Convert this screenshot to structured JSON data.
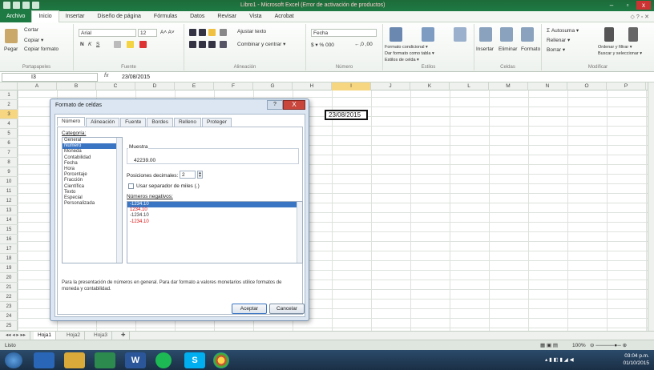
{
  "window": {
    "title": "Libro1 - Microsoft Excel (Error de activación de productos)",
    "controls": [
      "–",
      "▫",
      "x"
    ]
  },
  "ribbon_tabs": [
    "Archivo",
    "Inicio",
    "Insertar",
    "Diseño de página",
    "Fórmulas",
    "Datos",
    "Revisar",
    "Vista",
    "Acrobat"
  ],
  "ribbon": {
    "clipboard": {
      "paste": "Pegar",
      "cut": "Cortar",
      "copy": "Copiar ▾",
      "format_painter": "Copiar formato",
      "label": "Portapapeles"
    },
    "font": {
      "name": "Arial",
      "size": "12",
      "label": "Fuente",
      "bold": "N",
      "italic": "K",
      "underline": "S"
    },
    "alignment": {
      "wrap": "Ajustar texto",
      "merge": "Combinar y centrar ▾",
      "label": "Alineación"
    },
    "number": {
      "format": "Fecha",
      "currency": "$ ▾ % 000",
      "decimals": "←,0 ,00",
      "label": "Número"
    },
    "styles": {
      "conditional": "Formato condicional ▾",
      "as_table": "Dar formato como tabla ▾",
      "cell_styles": "Estilos de celda ▾",
      "label": "Estilos"
    },
    "cells": {
      "insert": "Insertar",
      "delete": "Eliminar",
      "format": "Formato",
      "label": "Celdas"
    },
    "editing": {
      "autosum": "Σ Autosuma ▾",
      "fill": "Rellenar ▾",
      "clear": "Borrar ▾",
      "sort": "Ordenar y filtrar ▾",
      "find": "Buscar y seleccionar ▾",
      "label": "Modificar"
    }
  },
  "formula_bar": {
    "cell_ref": "I3",
    "fx": "fx",
    "value": "23/08/2015"
  },
  "columns": [
    "A",
    "B",
    "C",
    "D",
    "E",
    "F",
    "G",
    "H",
    "I",
    "J",
    "K",
    "L",
    "M",
    "N",
    "O",
    "P"
  ],
  "rows": [
    "1",
    "2",
    "3",
    "4",
    "5",
    "6",
    "7",
    "8",
    "9",
    "10",
    "11",
    "12",
    "13",
    "14",
    "15",
    "16",
    "17",
    "18",
    "19",
    "20",
    "21",
    "22",
    "23",
    "24",
    "25"
  ],
  "active_cell_value": "23/08/2015",
  "sheets": [
    "Hoja1",
    "Hoja2",
    "Hoja3"
  ],
  "status": {
    "ready": "Listo",
    "zoom": "100%"
  },
  "taskbar": {
    "apps": [
      "W",
      "S"
    ],
    "time": "03:04 p.m.",
    "date": "01/10/2015"
  },
  "dialog": {
    "title": "Formato de celdas",
    "help": "?",
    "close": "X",
    "tabs": [
      "Número",
      "Alineación",
      "Fuente",
      "Bordes",
      "Relleno",
      "Proteger"
    ],
    "category_label": "Categoría:",
    "categories": [
      "General",
      "Número",
      "Moneda",
      "Contabilidad",
      "Fecha",
      "Hora",
      "Porcentaje",
      "Fracción",
      "Científica",
      "Texto",
      "Especial",
      "Personalizada"
    ],
    "selected_category": 1,
    "sample_label": "Muestra",
    "sample_value": "42239.00",
    "decimals_label": "Posiciones decimales:",
    "decimals_value": "2",
    "separator_label": "Usar separador de miles (.)",
    "negative_label": "Números negativos:",
    "negatives": [
      {
        "text": "-1234.10",
        "color": "#ffffff",
        "selected": true
      },
      {
        "text": "1234.10",
        "color": "#d11",
        "selected": false
      },
      {
        "text": "-1234.10",
        "color": "#333333",
        "selected": false
      },
      {
        "text": "-1234.10",
        "color": "#d11",
        "selected": false
      }
    ],
    "description": "Para la presentación de números en general. Para dar formato a valores monetarios utilice formatos de moneda y contabilidad.",
    "ok": "Aceptar",
    "cancel": "Cancelar"
  }
}
